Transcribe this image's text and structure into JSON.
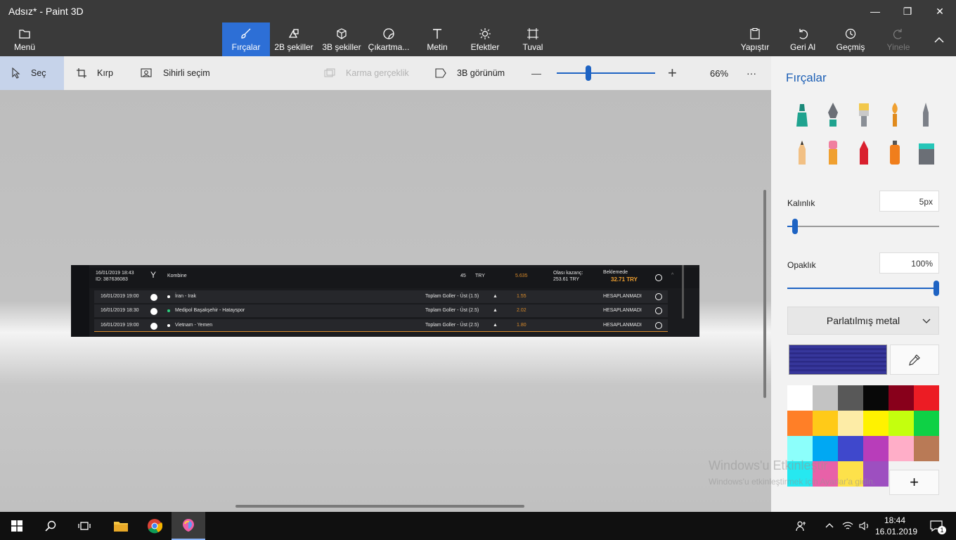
{
  "window": {
    "title": "Adsız* - Paint 3D",
    "minimize": "—",
    "maximize": "❐",
    "close": "✕"
  },
  "ribbon": {
    "menu": "Menü",
    "tabs": [
      "Fırçalar",
      "2B şekiller",
      "3B şekiller",
      "Çıkartma...",
      "Metin",
      "Efektler",
      "Tuval"
    ],
    "active_tab": "Fırçalar",
    "paste": "Yapıştır",
    "undo": "Geri Al",
    "history": "Geçmiş",
    "redo": "Yinele"
  },
  "toolbar": {
    "select": "Seç",
    "crop": "Kırp",
    "magic_select": "Sihirli seçim",
    "mixed_reality": "Karma gerçeklik",
    "view_3d": "3B görünüm",
    "zoom_minus": "—",
    "zoom_plus": "+",
    "zoom_level": "66%",
    "zoom_fraction": 0.32,
    "more": "···"
  },
  "slip": {
    "header": {
      "datetime": "16/01/2019 18:43",
      "id": "ID: 387636083",
      "type": "Kombine",
      "stake": "45",
      "currency": "TRY",
      "odds": "5.635",
      "potential_label": "Olası kazanç:",
      "potential_value": "253.61 TRY",
      "status": "Beklemede",
      "pending_amount": "32.71 TRY"
    },
    "rows": [
      {
        "date": "16/01/2019 19:00",
        "match": "İran - Irak",
        "market": "Toplam Goller - Üst (1.5)",
        "odds": "1.55",
        "result": "HESAPLANMADI"
      },
      {
        "date": "16/01/2019 18:30",
        "match": "Medipol Başakşehir - Hatayspor",
        "market": "Toplam Goller - Üst (2.5)",
        "odds": "2.02",
        "result": "HESAPLANMADI"
      },
      {
        "date": "16/01/2019 19:00",
        "match": "Vietnam - Yemen",
        "market": "Toplam Goller - Üst (2.5)",
        "odds": "1.80",
        "result": "HESAPLANMADI"
      }
    ]
  },
  "panel": {
    "title": "Fırçalar",
    "brushes": [
      "marker",
      "calligraphy-pen",
      "oil-brush",
      "watercolor",
      "pixel-pen",
      "pencil",
      "eraser",
      "crayon",
      "spray-can",
      "fill"
    ],
    "thickness_label": "Kalınlık",
    "thickness_value": "5px",
    "thickness_fraction": 0.05,
    "opacity_label": "Opaklık",
    "opacity_value": "100%",
    "opacity_fraction": 1.0,
    "material": "Parlatılmış metal",
    "current_color": "#2f2d8e",
    "add_color": "+",
    "palette": [
      "#ffffff",
      "#c3c3c3",
      "#585858",
      "#080808",
      "#88001b",
      "#ec1c24",
      "#ff7f27",
      "#ffca18",
      "#fdeca6",
      "#fff200",
      "#c4ff0e",
      "#0ed145",
      "#8cfffb",
      "#00a8f3",
      "#3f48cc",
      "#b83dba",
      "#ffaec8",
      "#b97a56",
      "#26e8f0",
      "#e861a8",
      "#fde14a",
      "#9d4fc0"
    ]
  },
  "watermark": {
    "line1": "Windows'u Etkinleştir",
    "line2": "Windows'u etkinleştirmek için Ayarlar'a gidin."
  },
  "taskbar": {
    "time": "18:44",
    "date": "16.01.2019",
    "notifications": "1"
  }
}
